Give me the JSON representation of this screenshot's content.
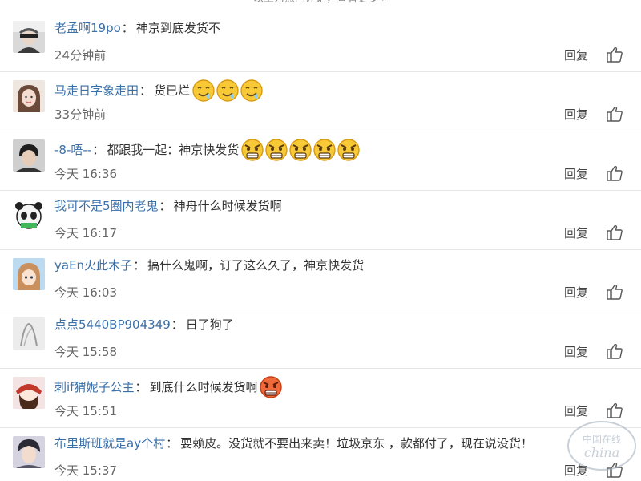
{
  "header": {
    "banner": "以上为热门评论，查看更多 »"
  },
  "comments": [
    {
      "user": "老孟啊19po",
      "text": "神京到底发货不",
      "time": "24分钟前",
      "reply": "回复",
      "emojis": []
    },
    {
      "user": "马走日字象走田",
      "text": "货已烂",
      "time": "33分钟前",
      "reply": "回复",
      "emojis": [
        "drool-face-icon",
        "drool-face-icon",
        "drool-face-icon"
      ]
    },
    {
      "user": "-8-唔--",
      "text": "都跟我一起：神京快发货",
      "time": "今天 16:36",
      "reply": "回复",
      "emojis": [
        "angry-face-icon",
        "angry-face-icon",
        "angry-face-icon",
        "angry-face-icon",
        "angry-face-icon"
      ]
    },
    {
      "user": "我可不是5圈内老鬼",
      "text": "神舟什么时候发货啊",
      "time": "今天 16:17",
      "reply": "回复",
      "emojis": []
    },
    {
      "user": "yaEn火此木子",
      "text": "搞什么鬼啊，订了这么久了，神京快发货",
      "time": "今天 16:03",
      "reply": "回复",
      "emojis": []
    },
    {
      "user": "点点5440BP904349",
      "text": "日了狗了",
      "time": "今天 15:58",
      "reply": "回复",
      "emojis": []
    },
    {
      "user": "刺if猬妮子公主",
      "text": "到底什么时候发货啊",
      "time": "今天 15:51",
      "reply": "回复",
      "emojis": [
        "furious-face-icon"
      ]
    },
    {
      "user": "布里斯班就是ay个村",
      "text": "耍赖皮。没货就不要出来卖！垃圾京东 ，款都付了，现在说没货！",
      "time": "今天 15:37",
      "reply": "回复",
      "emojis": []
    }
  ],
  "watermark": {
    "text": "中国在线 china"
  }
}
